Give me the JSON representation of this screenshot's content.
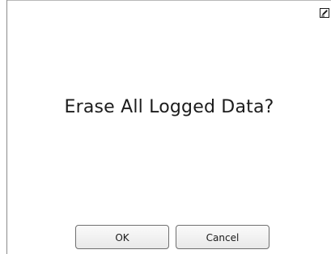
{
  "dialog": {
    "prompt": "Erase All Logged Data?",
    "ok_label": "OK",
    "cancel_label": "Cancel"
  },
  "icons": {
    "corner_icon": "edit-icon"
  }
}
